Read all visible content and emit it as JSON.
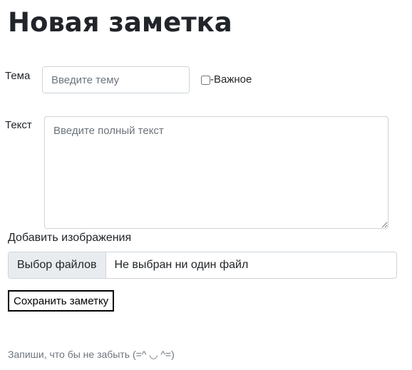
{
  "page": {
    "title": "Новая заметка"
  },
  "form": {
    "topic_label": "Тема",
    "topic_placeholder": "Введите тему",
    "topic_value": "",
    "important_label": "-Важное",
    "important_checked": false,
    "text_label": "Текст",
    "text_placeholder": "Введите полный текст",
    "text_value": "",
    "images_label": "Добавить изображения",
    "file_button_label": "Выбор файлов",
    "file_status": "Не выбран ни один файл",
    "save_label": "Сохранить заметку"
  },
  "footer": {
    "text": "Запиши, что бы не забыть (=^ ◡ ^=)"
  }
}
